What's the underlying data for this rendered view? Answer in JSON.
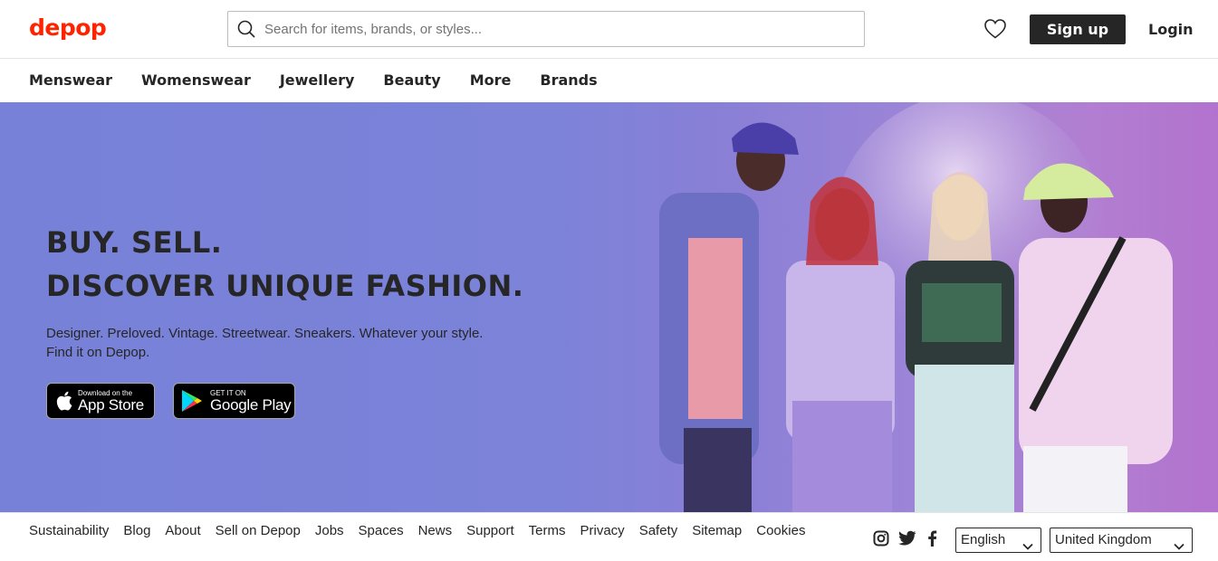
{
  "header": {
    "logo": "depop",
    "search_placeholder": "Search for items, brands, or styles...",
    "signup_label": "Sign up",
    "login_label": "Login"
  },
  "nav": {
    "items": [
      "Menswear",
      "Womenswear",
      "Jewellery",
      "Beauty",
      "More",
      "Brands"
    ]
  },
  "hero": {
    "headline_line1": "BUY. SELL.",
    "headline_line2": "DISCOVER UNIQUE FASHION.",
    "description": "Designer. Preloved. Vintage. Streetwear. Sneakers. Whatever your style. Find it on Depop.",
    "app_store": {
      "small": "Download on the",
      "big": "App Store"
    },
    "google_play": {
      "small": "GET IT ON",
      "big": "Google Play"
    }
  },
  "footer": {
    "links": [
      "Sustainability",
      "Blog",
      "About",
      "Sell on Depop",
      "Jobs",
      "Spaces",
      "News",
      "Support",
      "Terms",
      "Privacy",
      "Safety",
      "Sitemap",
      "Cookies"
    ],
    "language": "English",
    "country": "United Kingdom",
    "social_icons": [
      "instagram-icon",
      "twitter-icon",
      "facebook-icon"
    ]
  },
  "colors": {
    "brand": "#ff2300",
    "dark": "#262626",
    "hero_bg": "#7b83d9"
  }
}
